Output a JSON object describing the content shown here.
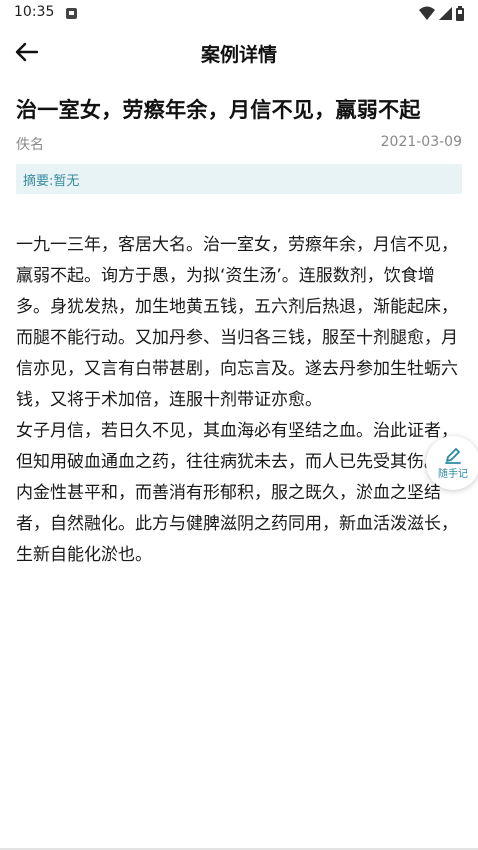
{
  "status_bar": {
    "time": "10:35",
    "icons": [
      "sim-card-icon",
      "wifi-icon",
      "cell-signal-icon",
      "battery-icon"
    ]
  },
  "app_bar": {
    "title": "案例详情",
    "back_icon": "arrow-left-icon"
  },
  "case": {
    "title": "治一室女，劳瘵年余，月信不见，羸弱不起",
    "author": "佚名",
    "date": "2021-03-09",
    "abstract": "摘要:暂无",
    "paragraphs": [
      "一九一三年，客居大名。治一室女，劳瘵年余，月信不见，羸弱不起。询方于愚，为拟‘资生汤’。连服数剂，饮食增多。身犹发热，加生地黄五钱，五六剂后热退，渐能起床，而腿不能行动。又加丹参、当归各三钱，服至十剂腿愈，月信亦见，又言有白带甚剧，向忘言及。遂去丹参加生牡蛎六钱，又将于术加倍，连服十剂带证亦愈。",
      "女子月信，若日久不见，其血海必有坚结之血。治此证者，但知用破血通血之药，往往病犹未去，而人已先受其伤。鸡内金性甚平和，而善消有形郁积，服之既久，淤血之坚结者，自然融化。此方与健脾滋阴之药同用，新血活泼滋长，生新自能化淤也。"
    ]
  },
  "note_fab": {
    "label": "随手记",
    "icon": "pencil-icon"
  },
  "colors": {
    "accent": "#2a8aa4",
    "abstract_bg": "#e8f3f6",
    "abstract_text": "#3a8c9c",
    "meta_text": "#8a8a8a"
  }
}
